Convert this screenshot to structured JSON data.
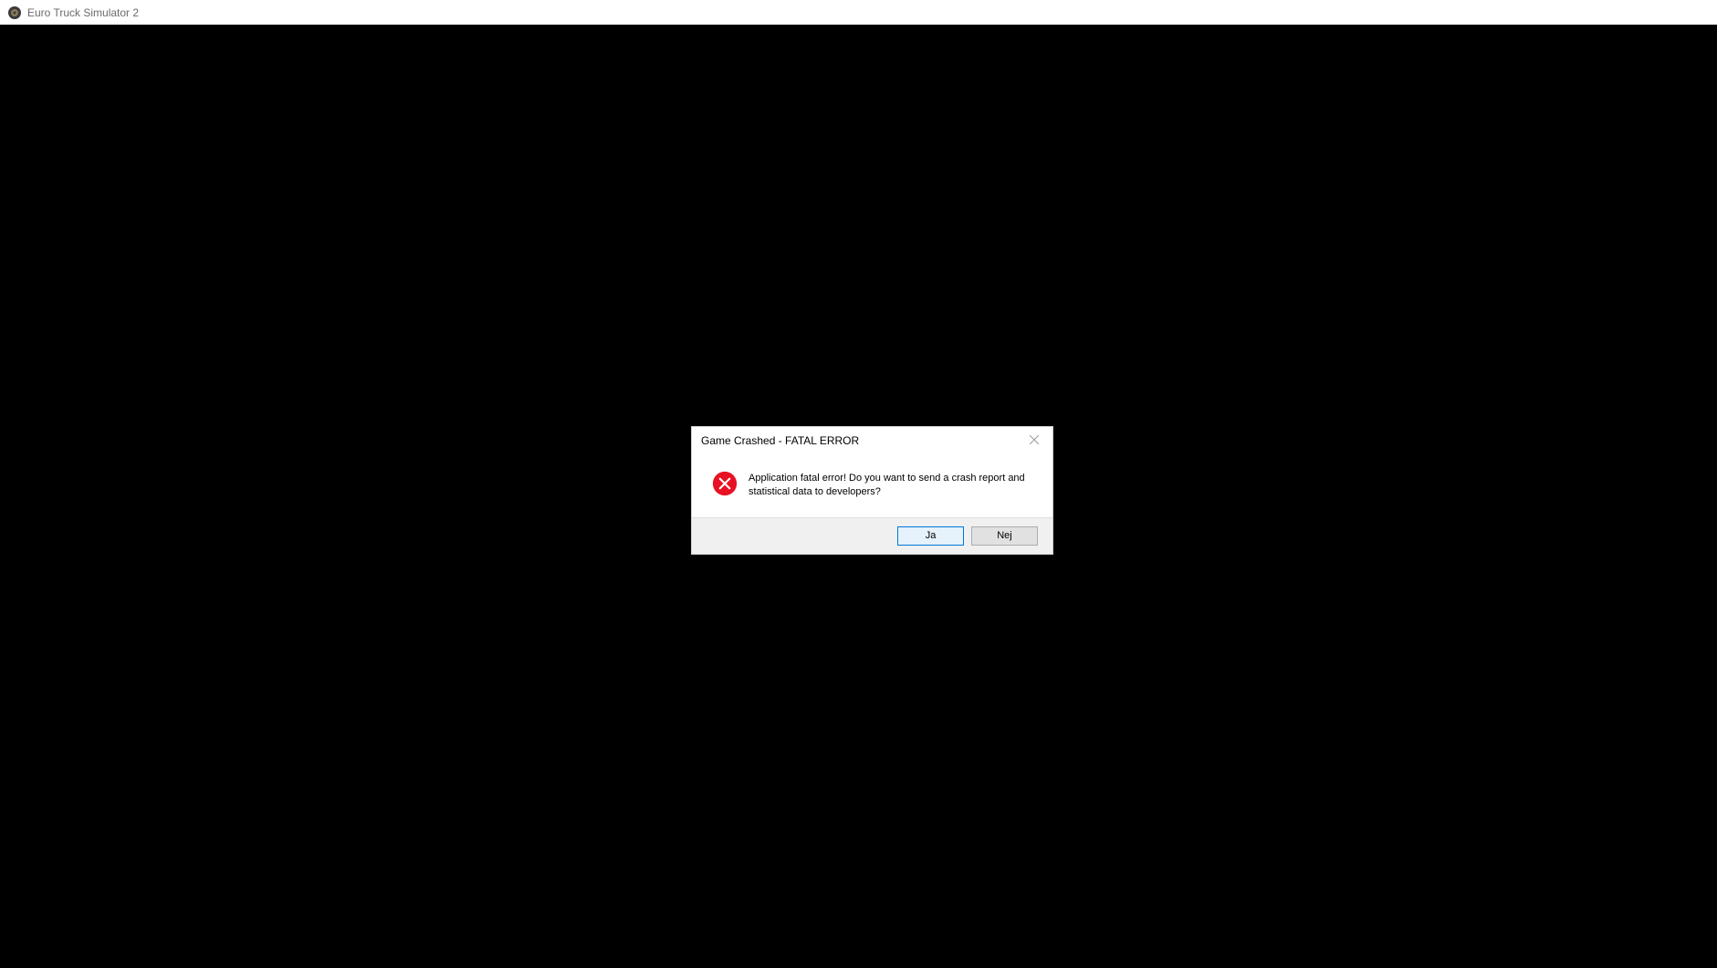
{
  "window": {
    "title": "Euro Truck Simulator 2"
  },
  "dialog": {
    "title": "Game Crashed - FATAL ERROR",
    "message": "Application fatal error! Do you want to send a crash report and statistical data to developers?",
    "buttons": {
      "yes": "Ja",
      "no": "Nej"
    }
  }
}
